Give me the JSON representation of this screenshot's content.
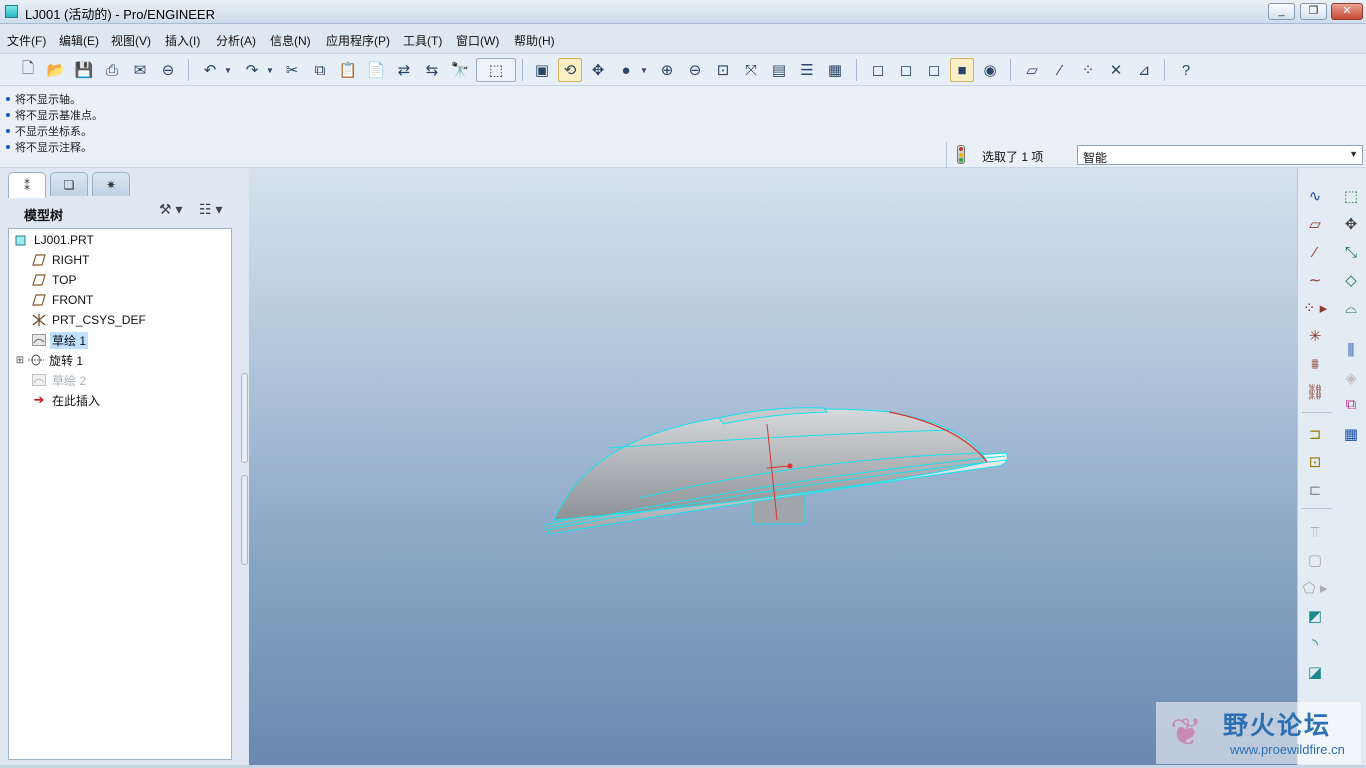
{
  "window": {
    "title": "LJ001 (活动的) - Pro/ENGINEER",
    "minimize": "_",
    "maximize": "❐",
    "close": "✕"
  },
  "menu": [
    "文件(F)",
    "编辑(E)",
    "视图(V)",
    "插入(I)",
    "分析(A)",
    "信息(N)",
    "应用程序(P)",
    "工具(T)",
    "窗口(W)",
    "帮助(H)"
  ],
  "messages": [
    "将不显示轴。",
    "将不显示基准点。",
    "不显示坐标系。",
    "将不显示注释。"
  ],
  "selection": {
    "count_text": "选取了 1 项",
    "filter": "智能"
  },
  "navigator": {
    "tab_icons": [
      "model-tree-tab-icon",
      "layer-tree-tab-icon",
      "folder-browser-tab-icon"
    ],
    "tree_title": "模型树",
    "settings_icon": "tree-settings-icon",
    "show_icon": "tree-show-icon"
  },
  "model_tree": [
    {
      "label": "LJ001.PRT",
      "icon": "part-icon"
    },
    {
      "label": "RIGHT",
      "icon": "datum-plane-icon"
    },
    {
      "label": "TOP",
      "icon": "datum-plane-icon"
    },
    {
      "label": "FRONT",
      "icon": "datum-plane-icon"
    },
    {
      "label": "PRT_CSYS_DEF",
      "icon": "csys-icon"
    },
    {
      "label": "草绘 1",
      "icon": "sketch-icon"
    },
    {
      "label": "旋转 1",
      "icon": "revolve-icon"
    },
    {
      "label": "草绘 2",
      "icon": "sketch-icon"
    },
    {
      "label": "在此插入",
      "icon": "insert-here-arrow-icon"
    }
  ],
  "toolbar_icons": [
    "new-icon",
    "open-icon",
    "save-icon",
    "print-icon",
    "send-mail-icon",
    "send-link-icon",
    "undo-icon",
    "redo-icon",
    "cut-icon",
    "copy-icon",
    "paste-icon",
    "paste-special-icon",
    "regenerate-icon",
    "regen-manager-icon",
    "find-icon",
    "selection-box-icon",
    "repaint-icon",
    "spin-center-icon",
    "orient-mode-icon",
    "shading-icon",
    "zoom-in-icon",
    "zoom-out-icon",
    "refit-icon",
    "reorient-icon",
    "saved-views-icon",
    "layers-icon",
    "view-manager-icon",
    "wireframe-icon",
    "hidden-line-icon",
    "no-hidden-icon",
    "shaded-icon",
    "enhanced-realism-icon",
    "plane-display-icon",
    "axis-display-icon",
    "point-display-icon",
    "csys-display-icon",
    "annotation-display-icon",
    "context-help-icon"
  ],
  "right_icons": [
    "sketched-datum-curve-icon",
    "datum-plane-tool-icon",
    "datum-axis-tool-icon",
    "datum-curve-tool-icon",
    "datum-point-tool-icon",
    "datum-csys-tool-icon",
    "analysis-feature-icon",
    "chain-icon",
    "sketch-tool-icon",
    "revolve-tool-icon",
    "sweep-icon",
    "blend-icon",
    "boundary-blend-icon",
    "mirror-icon",
    "merge-icon",
    "trim-icon",
    "pattern-icon",
    "extrude-tool-icon",
    "shell-icon",
    "rib-icon",
    "draft-icon",
    "round-icon",
    "chamfer-icon",
    "hole-icon"
  ],
  "watermark": {
    "title": "野火论坛",
    "url": "www.proewildfire.cn"
  }
}
